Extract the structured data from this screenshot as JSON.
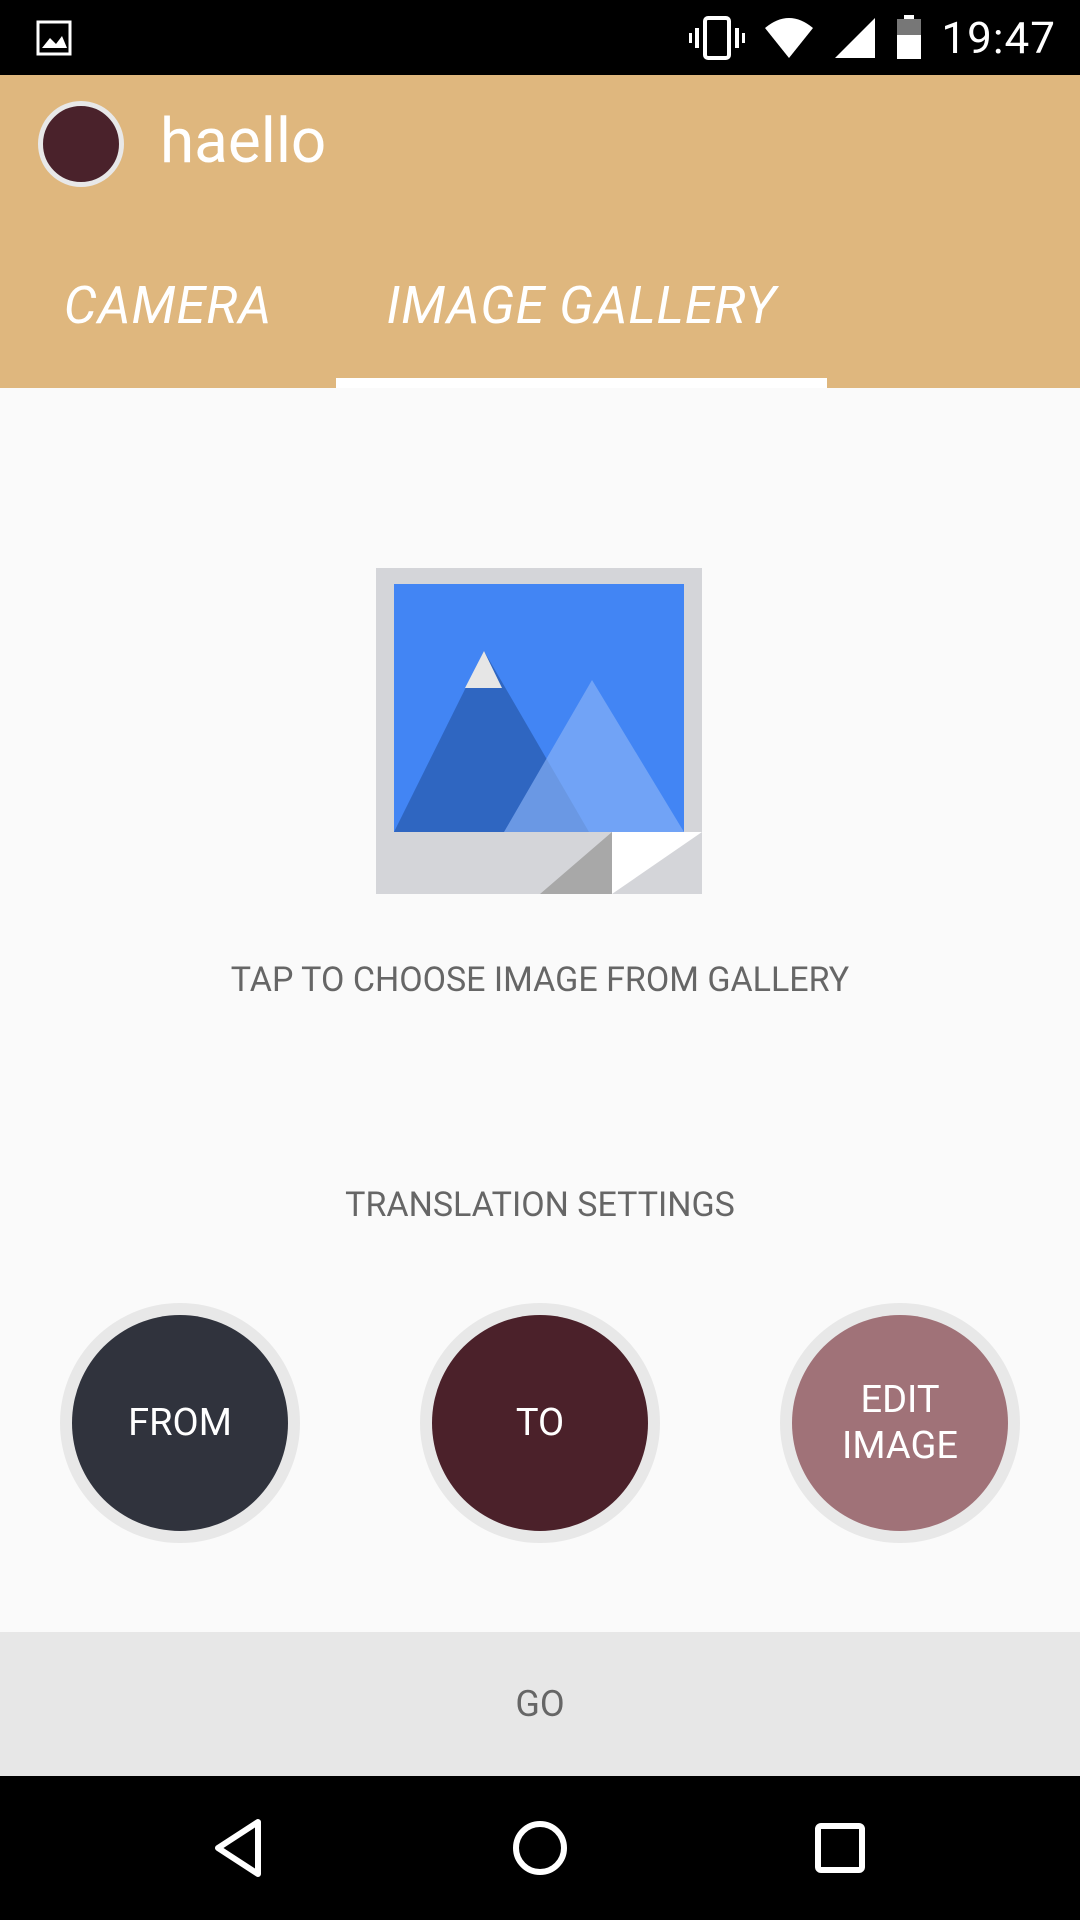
{
  "status_bar": {
    "time": "19:47",
    "icons": [
      "image-notification-icon",
      "vibrate-icon",
      "wifi-icon",
      "cell-signal-icon",
      "battery-icon"
    ]
  },
  "app": {
    "title": "haello",
    "brand_color": "#dfb77e"
  },
  "tabs": [
    {
      "label": "CAMERA",
      "selected": false
    },
    {
      "label": "IMAGE GALLERY",
      "selected": true
    }
  ],
  "main": {
    "picker_icon": "gallery-image-icon",
    "hint": "TAP TO CHOOSE IMAGE FROM GALLERY",
    "settings_label": "TRANSLATION SETTINGS",
    "buttons": {
      "from": "FROM",
      "to": "TO",
      "edit_line1": "EDIT",
      "edit_line2": "IMAGE"
    },
    "button_colors": {
      "from": "#30333d",
      "to": "#4b212a",
      "edit": "#a07278"
    }
  },
  "go_label": "GO",
  "nav": [
    "back-icon",
    "home-icon",
    "recents-icon"
  ]
}
